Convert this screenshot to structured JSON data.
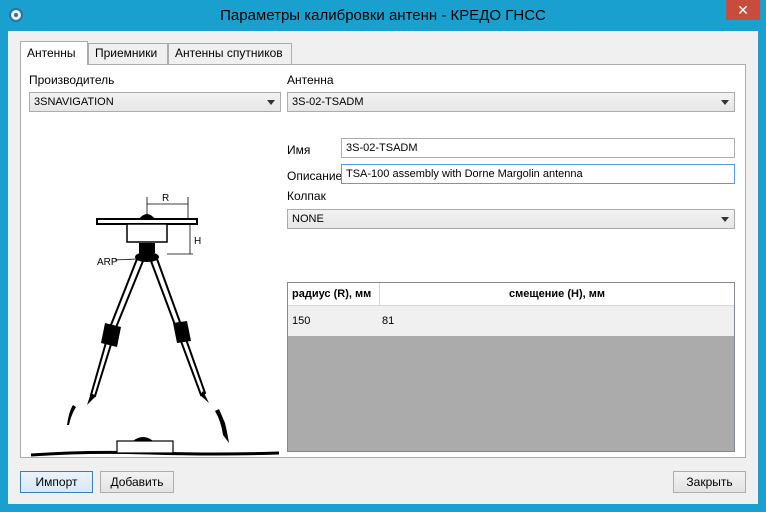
{
  "window": {
    "title": "Параметры калибровки антенн - КРЕДО ГНСС",
    "close_glyph": "✕"
  },
  "tabs": [
    {
      "label": "Антенны",
      "active": true
    },
    {
      "label": "Приемники",
      "active": false
    },
    {
      "label": "Антенны спутников",
      "active": false
    }
  ],
  "manufacturer": {
    "label": "Производитель",
    "value": "3SNAVIGATION"
  },
  "antenna": {
    "label": "Антенна",
    "value": "3S-02-TSADM"
  },
  "name": {
    "label": "Имя",
    "value": "3S-02-TSADM"
  },
  "description": {
    "label": "Описание",
    "value": "TSA-100 assembly with Dorne Margolin antenna"
  },
  "radome": {
    "label": "Колпак",
    "value": "NONE"
  },
  "grid": {
    "headers": [
      "радиус (R), мм",
      "смещение (H), мм"
    ],
    "rows": [
      [
        "150",
        "81"
      ]
    ]
  },
  "diagram": {
    "label_r": "R",
    "label_h": "H",
    "label_arp": "ARP"
  },
  "buttons": {
    "import": "Импорт",
    "add": "Добавить",
    "close": "Закрыть"
  },
  "colors": {
    "title_bar": "#1aa0cf",
    "close_button": "#c74c3c"
  }
}
